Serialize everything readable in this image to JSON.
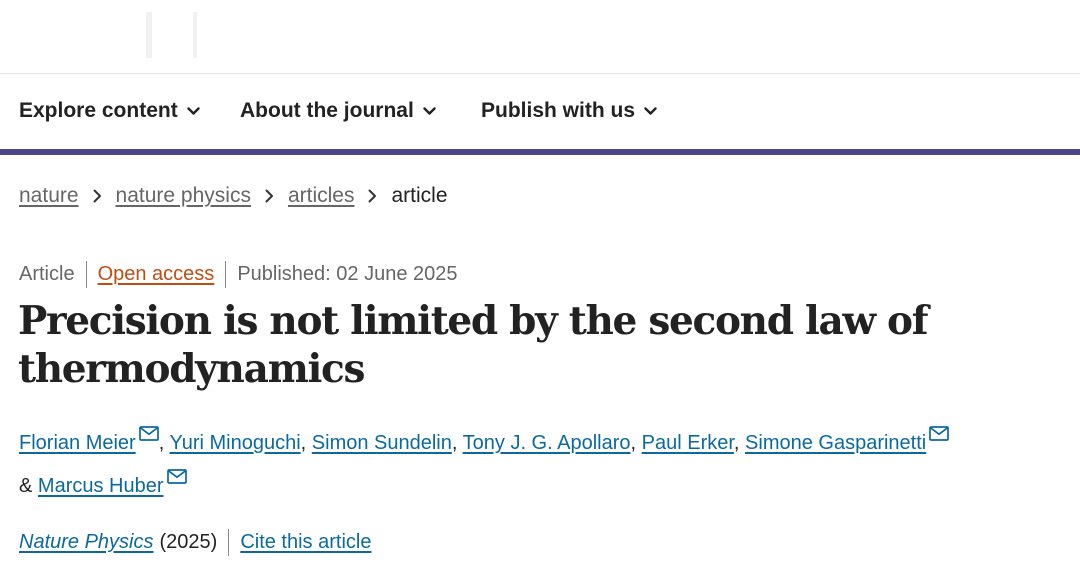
{
  "nav": {
    "items": [
      {
        "label": "Explore content",
        "icon": "chevron-down-icon"
      },
      {
        "label": "About the journal",
        "icon": "chevron-down-icon"
      },
      {
        "label": "Publish with us",
        "icon": "chevron-down-icon"
      }
    ],
    "accent_color": "#4b4886"
  },
  "breadcrumb": {
    "items": [
      "nature",
      "nature physics",
      "articles"
    ],
    "current": "article",
    "separator_icon": "chevron-right-icon"
  },
  "article": {
    "type": "Article",
    "access": "Open access",
    "published": "Published: 02 June 2025",
    "title": "Precision is not limited by the second law of thermodynamics",
    "authors": [
      {
        "name": "Florian Meier",
        "email": true
      },
      {
        "name": "Yuri Minoguchi",
        "email": false
      },
      {
        "name": "Simon Sundelin",
        "email": false
      },
      {
        "name": "Tony J. G. Apollaro",
        "email": false
      },
      {
        "name": "Paul Erker",
        "email": false
      },
      {
        "name": "Simone Gasparinetti",
        "email": true
      },
      {
        "name": "Marcus Huber",
        "email": true
      }
    ],
    "author_separator": ",",
    "last_author_conjunction": "&",
    "journal": "Nature Physics",
    "year": "(2025)",
    "cite_label": "Cite this article"
  },
  "colors": {
    "link": "#0b6a9d",
    "open_access": "#c04d13",
    "muted_text": "#666666",
    "text": "#222222"
  }
}
